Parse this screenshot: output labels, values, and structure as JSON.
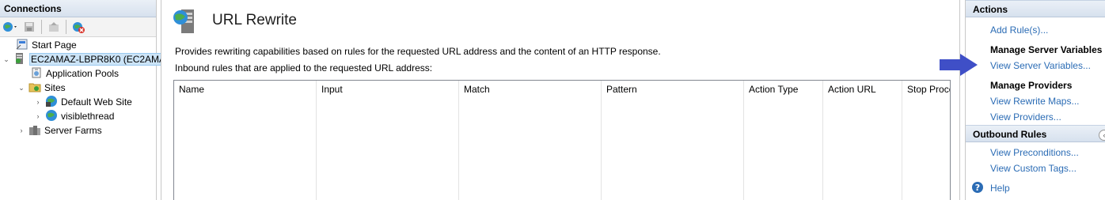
{
  "connections": {
    "header": "Connections",
    "tree": [
      {
        "label": "Start Page",
        "icon": "start-page-icon"
      },
      {
        "label": "EC2AMAZ-LBPR8K0 (EC2AMA",
        "icon": "server-icon"
      },
      {
        "label": "Application Pools",
        "icon": "app-pools-icon"
      },
      {
        "label": "Sites",
        "icon": "sites-folder-icon"
      },
      {
        "label": "Default Web Site",
        "icon": "globe-icon"
      },
      {
        "label": "visiblethread",
        "icon": "globe-icon"
      },
      {
        "label": "Server Farms",
        "icon": "server-farms-icon"
      }
    ]
  },
  "main": {
    "title": "URL Rewrite",
    "description": "Provides rewriting capabilities based on rules for the requested URL address and the content of an HTTP response.",
    "inbound_label": "Inbound rules that are applied to the requested URL address:",
    "columns": [
      "Name",
      "Input",
      "Match",
      "Pattern",
      "Action Type",
      "Action URL",
      "Stop Proce"
    ]
  },
  "actions": {
    "header": "Actions",
    "add_rules": "Add Rule(s)...",
    "manage_server_variables": "Manage Server Variables",
    "view_server_variables": "View Server Variables...",
    "manage_providers": "Manage Providers",
    "view_rewrite_maps": "View Rewrite Maps...",
    "view_providers": "View Providers...",
    "outbound_rules": "Outbound Rules",
    "view_preconditions": "View Preconditions...",
    "view_custom_tags": "View Custom Tags...",
    "help": "Help"
  },
  "colors": {
    "link": "#2b6cb5",
    "header_gradient_top": "#eaf0f7",
    "header_gradient_bottom": "#d7e1ee",
    "arrow": "#3f4fc7"
  }
}
